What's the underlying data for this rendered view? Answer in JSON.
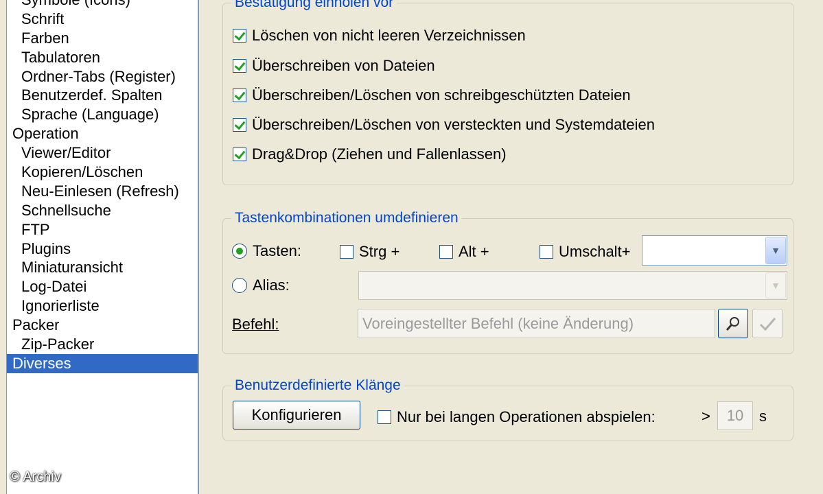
{
  "tree": {
    "items": [
      {
        "label": "Symbole (Icons)",
        "level": 2
      },
      {
        "label": "Schrift",
        "level": 2
      },
      {
        "label": "Farben",
        "level": 2
      },
      {
        "label": "Tabulatoren",
        "level": 2
      },
      {
        "label": "Ordner-Tabs (Register)",
        "level": 2
      },
      {
        "label": "Benutzerdef. Spalten",
        "level": 2
      },
      {
        "label": "Sprache (Language)",
        "level": 2
      },
      {
        "label": "Operation",
        "level": 1
      },
      {
        "label": "Viewer/Editor",
        "level": 2
      },
      {
        "label": "Kopieren/Löschen",
        "level": 2
      },
      {
        "label": "Neu-Einlesen (Refresh)",
        "level": 2
      },
      {
        "label": "Schnellsuche",
        "level": 2
      },
      {
        "label": "FTP",
        "level": 2
      },
      {
        "label": "Plugins",
        "level": 2
      },
      {
        "label": "Miniaturansicht",
        "level": 2
      },
      {
        "label": "Log-Datei",
        "level": 2
      },
      {
        "label": "Ignorierliste",
        "level": 2
      },
      {
        "label": "Packer",
        "level": 1
      },
      {
        "label": "Zip-Packer",
        "level": 2
      },
      {
        "label": "Diverses",
        "level": 1,
        "selected": true
      }
    ]
  },
  "confirm": {
    "title": "Bestätigung einholen vor",
    "items": [
      {
        "label": "Löschen von nicht leeren Verzeichnissen",
        "checked": true
      },
      {
        "label": "Überschreiben von Dateien",
        "checked": true
      },
      {
        "label": "Überschreiben/Löschen von schreibgeschützten Dateien",
        "checked": true
      },
      {
        "label": "Überschreiben/Löschen von versteckten und Systemdateien",
        "checked": true
      },
      {
        "label": "Drag&Drop (Ziehen und Fallenlassen)",
        "checked": true
      }
    ]
  },
  "hotkeys": {
    "title": "Tastenkombinationen umdefinieren",
    "tasten_label": "Tasten:",
    "strg_label": "Strg +",
    "alt_label": "Alt +",
    "umschalt_label": "Umschalt+",
    "alias_label": "Alias:",
    "befehl_label": "Befehl:",
    "befehl_placeholder": "Voreingestellter Befehl (keine Änderung)"
  },
  "sounds": {
    "title": "Benutzerdefinierte Klänge",
    "configure_label": "Konfigurieren",
    "long_ops_label": "Nur bei langen Operationen abspielen:",
    "gt": ">",
    "seconds_value": "10",
    "seconds_unit": "s"
  },
  "watermark": "© Archiv",
  "colors": {
    "accent": "#0046d5",
    "selection": "#316ac5",
    "check": "#21a121"
  }
}
